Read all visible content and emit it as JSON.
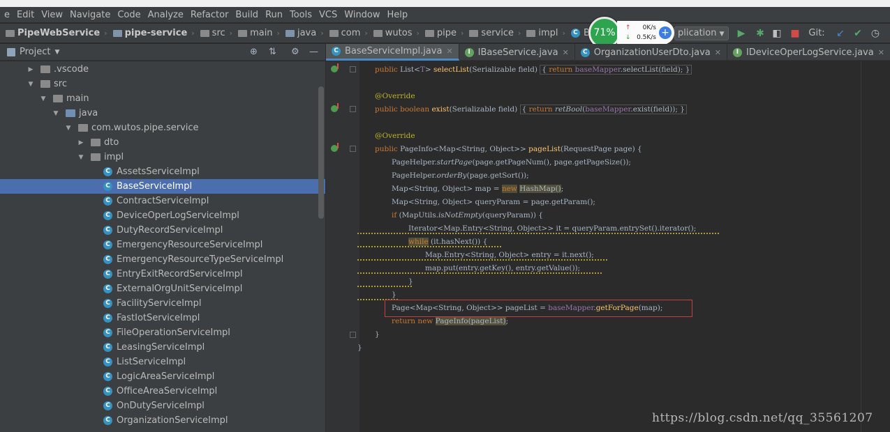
{
  "menu": [
    "e",
    "Edit",
    "View",
    "Navigate",
    "Code",
    "Analyze",
    "Refactor",
    "Build",
    "Run",
    "Tools",
    "VCS",
    "Window",
    "Help"
  ],
  "breadcrumb": [
    "PipeWebService",
    "pipe-service",
    "src",
    "main",
    "java",
    "com",
    "wutos",
    "pipe",
    "service",
    "impl",
    "BaseServiceImpl"
  ],
  "perf": {
    "percent": "71%",
    "up": "0K/s",
    "down": "0.5K/s"
  },
  "run_config": "plication",
  "git_label": "Git:",
  "project": {
    "title": "Project",
    "tree": [
      {
        "label": ".vscode",
        "depth": 0,
        "arrow": "▶",
        "kind": "gray"
      },
      {
        "label": "src",
        "depth": 0,
        "arrow": "▼",
        "kind": "gray"
      },
      {
        "label": "main",
        "depth": 1,
        "arrow": "▼",
        "kind": "gray"
      },
      {
        "label": "java",
        "depth": 2,
        "arrow": "▼",
        "kind": "blue"
      },
      {
        "label": "com.wutos.pipe.service",
        "depth": 3,
        "arrow": "▼",
        "kind": "pkg"
      },
      {
        "label": "dto",
        "depth": 4,
        "arrow": "▶",
        "kind": "pkg"
      },
      {
        "label": "impl",
        "depth": 4,
        "arrow": "▼",
        "kind": "pkg"
      },
      {
        "label": "AssetsServiceImpl",
        "depth": 5,
        "kind": "class"
      },
      {
        "label": "BaseServiceImpl",
        "depth": 5,
        "kind": "class",
        "selected": true
      },
      {
        "label": "ContractServiceImpl",
        "depth": 5,
        "kind": "class"
      },
      {
        "label": "DeviceOperLogServiceImpl",
        "depth": 5,
        "kind": "class"
      },
      {
        "label": "DutyRecordServiceImpl",
        "depth": 5,
        "kind": "class"
      },
      {
        "label": "EmergencyResourceServiceImpl",
        "depth": 5,
        "kind": "class"
      },
      {
        "label": "EmergencyResourceTypeServiceImpl",
        "depth": 5,
        "kind": "class"
      },
      {
        "label": "EntryExitRecordServiceImpl",
        "depth": 5,
        "kind": "class"
      },
      {
        "label": "ExternalOrgUnitServiceImpl",
        "depth": 5,
        "kind": "class"
      },
      {
        "label": "FacilityServiceImpl",
        "depth": 5,
        "kind": "class"
      },
      {
        "label": "FastIotServiceImpl",
        "depth": 5,
        "kind": "class"
      },
      {
        "label": "FileOperationServiceImpl",
        "depth": 5,
        "kind": "class"
      },
      {
        "label": "LeasingServiceImpl",
        "depth": 5,
        "kind": "class"
      },
      {
        "label": "ListServiceImpl",
        "depth": 5,
        "kind": "class"
      },
      {
        "label": "LogicAreaServiceImpl",
        "depth": 5,
        "kind": "class"
      },
      {
        "label": "OfficeAreaServiceImpl",
        "depth": 5,
        "kind": "class"
      },
      {
        "label": "OnDutyServiceImpl",
        "depth": 5,
        "kind": "class"
      },
      {
        "label": "OrganizationServiceImpl",
        "depth": 5,
        "kind": "class"
      }
    ]
  },
  "tabs": [
    {
      "label": "BaseServiceImpl.java",
      "kind": "c",
      "active": true
    },
    {
      "label": "IBaseService.java",
      "kind": "i"
    },
    {
      "label": "OrganizationUserDto.java",
      "kind": "c"
    },
    {
      "label": "IDeviceOperLogService.java",
      "kind": "i"
    }
  ],
  "code": [
    {
      "indent": 1,
      "html": "<span class='kw'>public</span> List&lt;<span class='fld'>T</span>&gt; <span class='fn'>selectList</span>(Serializable field) <span class='fold-box'>{ <span class='kw'>return</span> <span class='fld'>baseMapper</span>.selectList(field); }</span>"
    },
    {
      "indent": 0,
      "html": ""
    },
    {
      "indent": 1,
      "html": "<span class='an'>@Override</span>"
    },
    {
      "indent": 1,
      "html": "<span class='kw'>public boolean</span> <span class='fn'>exist</span>(Serializable field) <span class='fold-box'>{ <span class='kw'>return</span> <span class='it'>retBool</span>(<span class='fld'>baseMapper</span>.exist(field)); }</span>"
    },
    {
      "indent": 0,
      "html": ""
    },
    {
      "indent": 1,
      "html": "<span class='an'>@Override</span>"
    },
    {
      "indent": 1,
      "html": "<span class='kw'>public</span> PageInfo&lt;Map&lt;String, Object&gt;&gt; <span class='fn'>pageList</span>(RequestPage page) {"
    },
    {
      "indent": 2,
      "html": "PageHelper.<span class='it'>startPage</span>(page.getPageNum(), page.getPageSize());"
    },
    {
      "indent": 2,
      "html": "PageHelper.<span class='it'>orderBy</span>(page.getSort());"
    },
    {
      "indent": 2,
      "html": "Map&lt;String, Object&gt; map = <span class='kw hly'>new</span> <span class='hly'>HashMap()</span>;"
    },
    {
      "indent": 2,
      "html": "Map&lt;String, Object&gt; queryParam = page.getParam();"
    },
    {
      "indent": 2,
      "html": "<span class='kw'>if</span> (MapUtils.<span class='it'>isNotEmpty</span>(queryParam)) {"
    },
    {
      "indent": 3,
      "html": "Iterator&lt;Map.Entry&lt;String, Object&gt;&gt; it = queryParam.entrySet().iterator();"
    },
    {
      "indent": 3,
      "html": "<span class='kw hly'>while</span> (it.hasNext()) {"
    },
    {
      "indent": 4,
      "html": "Map.Entry&lt;String, Object&gt; entry = it.next();"
    },
    {
      "indent": 4,
      "html": "map.put(entry.getKey(), entry.getValue());"
    },
    {
      "indent": 3,
      "html": "}"
    },
    {
      "indent": 2,
      "html": "}"
    },
    {
      "indent": 2,
      "html": "Page&lt;Map&lt;String, Object&gt;&gt; pageList = <span class='fld'>baseMapper</span>.<span class='fn'>getForPage</span>(map);"
    },
    {
      "indent": 2,
      "html": "<span class='kw'>return new</span> <span class='hly'>PageInfo(pageList)</span>;"
    },
    {
      "indent": 1,
      "html": "}"
    },
    {
      "indent": 0,
      "html": "}"
    }
  ],
  "watermark": "https://blog.csdn.net/qq_35561207"
}
